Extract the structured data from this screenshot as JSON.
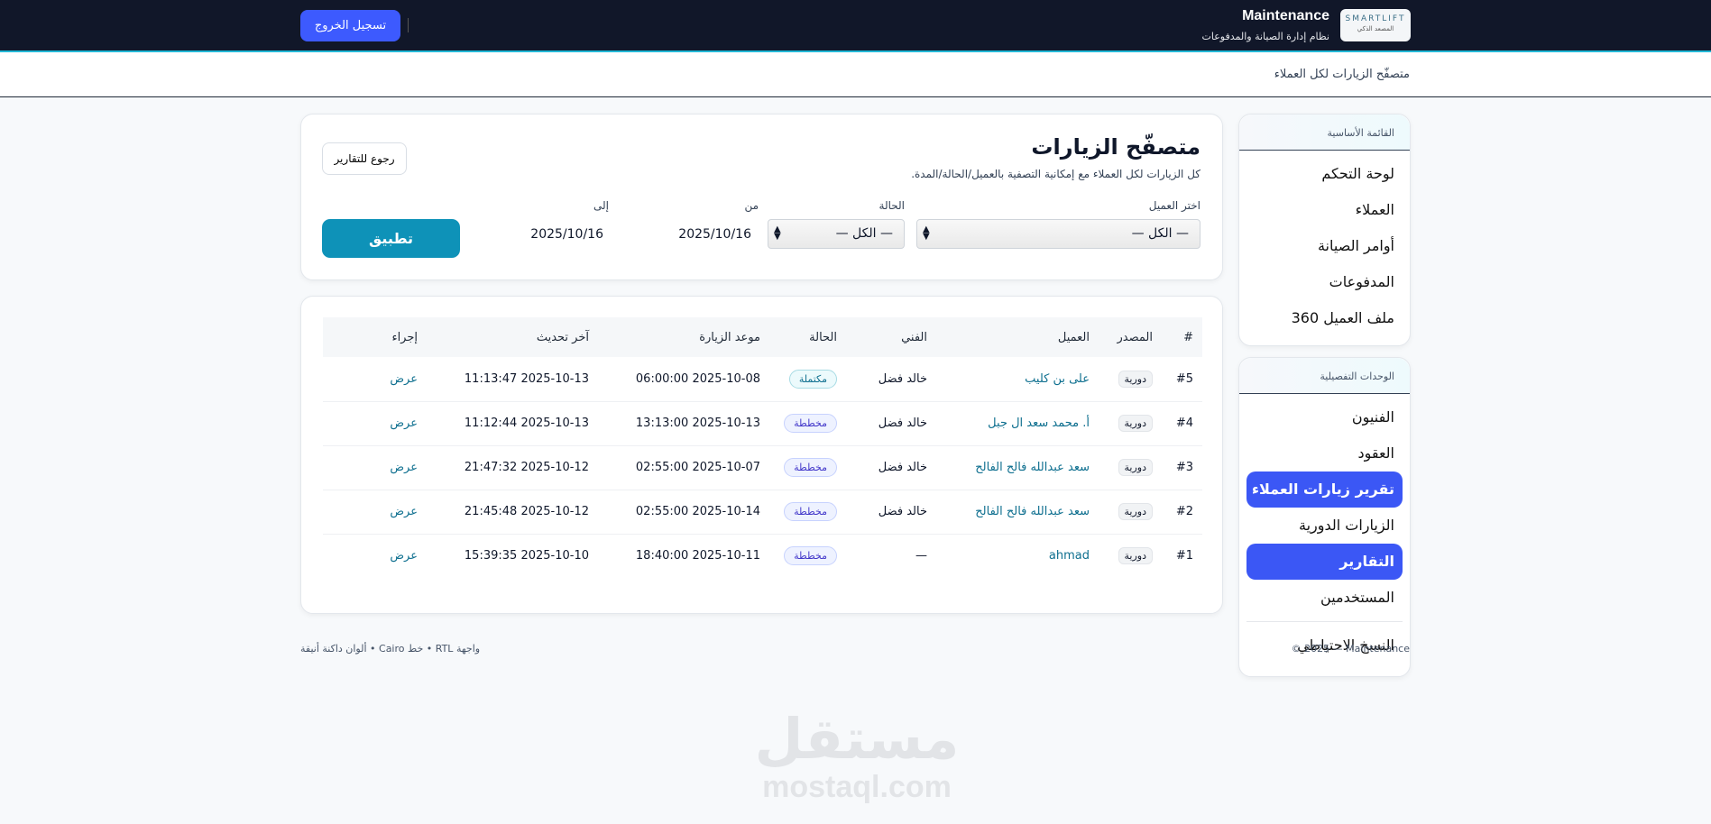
{
  "header": {
    "title": "Maintenance",
    "subtitle": "نظام إدارة الصيانة والمدفوعات",
    "logo_text": "SMARTLIFT",
    "logo_sub": "المصعد الذكي",
    "logout": "تسجيل الخروج"
  },
  "breadcrumb": "متصفّح الزيارات لكل العملاء",
  "sidebar": {
    "main_title": "القائمة الأساسية",
    "main_items": [
      "لوحة التحكم",
      "العملاء",
      "أوامر الصيانة",
      "المدفوعات",
      "ملف العميل 360"
    ],
    "detail_title": "الوحدات التفصيلية",
    "detail_items": [
      "الفنيون",
      "العقود",
      "تقرير زيارات العملاء",
      "الزيارات الدورية",
      "التقارير",
      "المستخدمين"
    ],
    "backup": "النسخ الاحتياطي"
  },
  "filter": {
    "title": "متصفّح الزيارات",
    "subtitle": "كل الزيارات لكل العملاء مع إمكانية التصفية بالعميل/الحالة/المدة.",
    "back": "رجوع للتقارير",
    "client_label": "اختر العميل",
    "client_value": "— الكل —",
    "status_label": "الحالة",
    "status_value": "— الكل —",
    "from_label": "من",
    "from_value": "2025/10/16",
    "to_label": "إلى",
    "to_value": "2025/10/16",
    "apply": "تطبيق"
  },
  "table": {
    "headers": [
      "#",
      "المصدر",
      "العميل",
      "الفني",
      "الحالة",
      "موعد الزيارة",
      "آخر تحديث",
      "إجراء"
    ],
    "rows": [
      {
        "id": "#5",
        "source": "دورية",
        "client": "على بن كليب",
        "tech": "خالد فضل",
        "status": "مكتملة",
        "visit": "2025-10-08 06:00:00",
        "updated": "2025-10-13 11:13:47",
        "action": "عرض"
      },
      {
        "id": "#4",
        "source": "دورية",
        "client": "أ. محمد سعد ال جبل",
        "tech": "خالد فضل",
        "status": "مخططة",
        "visit": "2025-10-13 13:13:00",
        "updated": "2025-10-13 11:12:44",
        "action": "عرض"
      },
      {
        "id": "#3",
        "source": "دورية",
        "client": "سعد عبدالله فالح الفالح",
        "tech": "خالد فضل",
        "status": "مخططة",
        "visit": "2025-10-07 02:55:00",
        "updated": "2025-10-12 21:47:32",
        "action": "عرض"
      },
      {
        "id": "#2",
        "source": "دورية",
        "client": "سعد عبدالله فالح الفالح",
        "tech": "خالد فضل",
        "status": "مخططة",
        "visit": "2025-10-14 02:55:00",
        "updated": "2025-10-12 21:45:48",
        "action": "عرض"
      },
      {
        "id": "#1",
        "source": "دورية",
        "client": "ahmad",
        "tech": "—",
        "status": "مخططة",
        "visit": "2025-10-11 18:40:00",
        "updated": "2025-10-10 15:39:35",
        "action": "عرض"
      }
    ]
  },
  "footer": {
    "copyright": "© 2025 — Maintenance",
    "note": "واجهة RTL • خط Cairo • ألوان داكنة أنيقة"
  },
  "watermark": {
    "arabic": "مستقل",
    "latin": "mostaql.com"
  }
}
